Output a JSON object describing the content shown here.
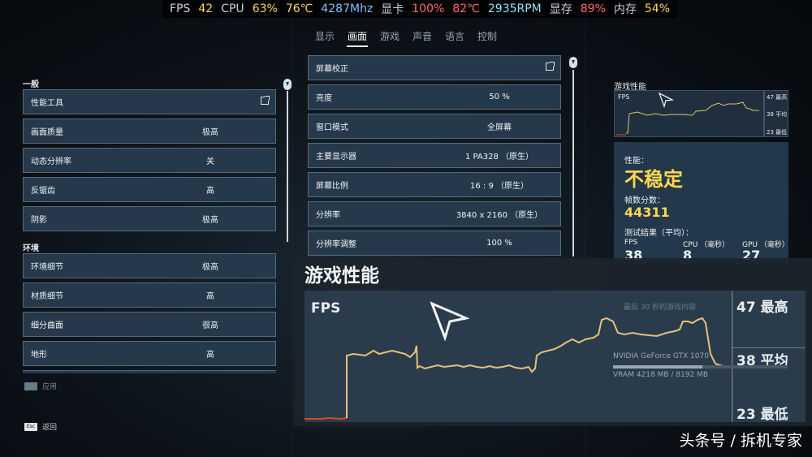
{
  "hud": {
    "fps_label": "FPS",
    "fps": "42",
    "cpu_label": "CPU",
    "cpu_usage": "63%",
    "cpu_temp": "76℃",
    "cpu_clock": "4287Mhz",
    "gpu_label": "显卡",
    "gpu_usage": "100%",
    "gpu_temp": "82℃",
    "gpu_fan": "2935RPM",
    "vram_label": "显存",
    "vram": "89%",
    "ram_label": "内存",
    "ram": "54%"
  },
  "nav": {
    "tabs": [
      "显示",
      "画面",
      "游戏",
      "声音",
      "语言",
      "控制"
    ],
    "active_index": 1
  },
  "left": {
    "general_heading": "一般",
    "general": [
      {
        "label": "性能工具",
        "value": ""
      },
      {
        "label": "画面质量",
        "value": "极高"
      },
      {
        "label": "动态分辨率",
        "value": "关"
      },
      {
        "label": "反锯齿",
        "value": "高"
      },
      {
        "label": "阴影",
        "value": "极高"
      }
    ],
    "env_heading": "环境",
    "env": [
      {
        "label": "环境细节",
        "value": "极高"
      },
      {
        "label": "材质细节",
        "value": "高"
      },
      {
        "label": "细分曲面",
        "value": "很高"
      },
      {
        "label": "地形",
        "value": "高"
      }
    ]
  },
  "middle": {
    "rows": [
      {
        "label": "屏幕校正",
        "value": ""
      },
      {
        "label": "亮度",
        "value": "50 %"
      },
      {
        "label": "窗口模式",
        "value": "全屏幕"
      },
      {
        "label": "主要显示器",
        "value": "1 PA328 （原生）"
      },
      {
        "label": "屏幕比例",
        "value": "16 : 9 （原生）"
      },
      {
        "label": "分辨率",
        "value": "3840 x 2160 （原生）"
      },
      {
        "label": "分辨率调整",
        "value": "100 %"
      }
    ]
  },
  "right": {
    "mini_title": "游戏性能",
    "mini_fps": "FPS",
    "mini_max": "47 最高",
    "mini_avg": "38 平均",
    "mini_min": "23 最低",
    "perf_label": "性能：",
    "perf_status": "不稳定",
    "frame_label": "帧数分数：",
    "frame_score": "44311",
    "avg_label": "测试结果（平均）：",
    "cols": [
      {
        "label": "FPS",
        "value": "38"
      },
      {
        "label": "CPU （毫秒）",
        "value": "8"
      },
      {
        "label": "GPU （毫秒）",
        "value": "27"
      }
    ]
  },
  "overlay": {
    "title": "游戏性能",
    "fps_label": "FPS",
    "max": "47 最高",
    "avg": "38 平均",
    "min": "23 最低",
    "hint": "最后 30 秒的游戏内容",
    "gpu_name": "NVIDIA GeForce GTX 1070",
    "vram_text": "VRAM 4218 MB / 8192 MB"
  },
  "bottom": {
    "apply": "应用",
    "back": "返回",
    "esc_key": "Esc"
  },
  "watermark": "头条号 / 拆机专家",
  "colors": {
    "accent": "#ffd84d",
    "row_bg": "#26394b",
    "graph_line": "#e2c27a",
    "graph_low": "#d84a2a"
  }
}
